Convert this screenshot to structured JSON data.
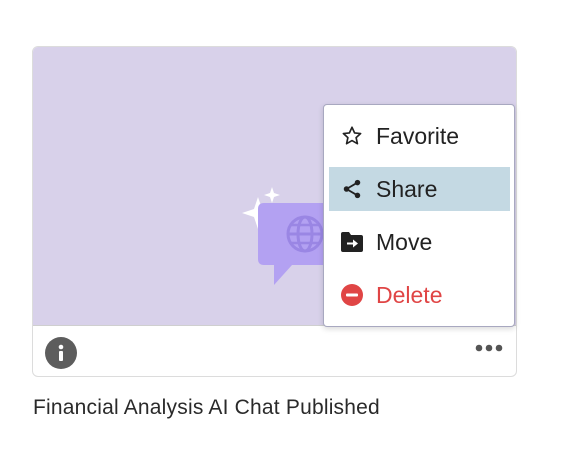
{
  "card": {
    "title": "Financial Analysis AI Chat Published"
  },
  "menu": {
    "items": [
      {
        "label": "Favorite",
        "icon": "star-outline-icon",
        "state": "normal"
      },
      {
        "label": "Share",
        "icon": "share-icon",
        "state": "active"
      },
      {
        "label": "Move",
        "icon": "folder-move-icon",
        "state": "normal"
      },
      {
        "label": "Delete",
        "icon": "minus-circle-icon",
        "state": "danger"
      }
    ]
  },
  "colors": {
    "thumbnail_bg": "#d8d1ea",
    "menu_active_bg": "#c4d9e3",
    "delete_red": "#e04545",
    "chat_bubble": "#b3a1f2",
    "sparkle_red": "#e5475e"
  }
}
